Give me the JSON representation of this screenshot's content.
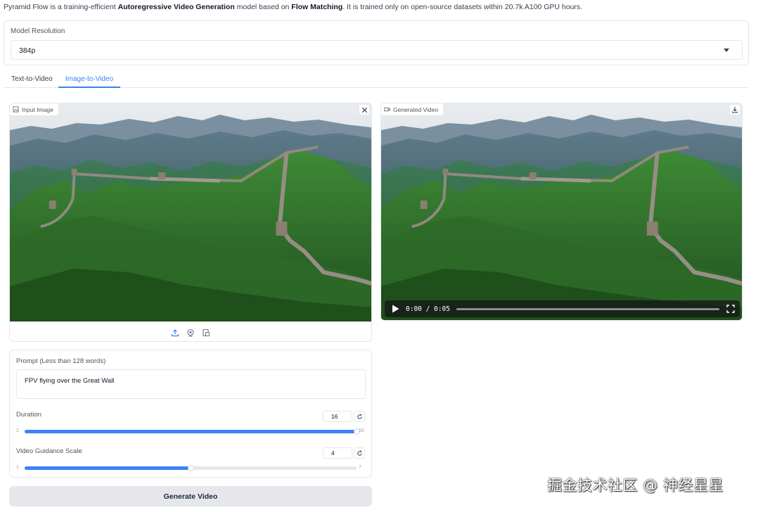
{
  "intro": {
    "p1": "Pyramid Flow is a training-efficient ",
    "b1": "Autoregressive Video Generation",
    "p2": " model based on ",
    "b2": "Flow Matching",
    "p3": ". It is trained only on open-source datasets within 20.7k A100 GPU hours."
  },
  "resolution": {
    "label": "Model Resolution",
    "value": "384p"
  },
  "tabs": [
    {
      "label": "Text-to-Video",
      "active": false
    },
    {
      "label": "Image-to-Video",
      "active": true
    }
  ],
  "input_image": {
    "label": "Input Image",
    "icons": [
      "image-icon",
      "close-icon",
      "upload-icon",
      "webcam-icon",
      "clipboard-icon"
    ]
  },
  "generated_video": {
    "label": "Generated Video",
    "time": "0:00 / 0:05",
    "progress": 0,
    "icons": [
      "video-icon",
      "download-icon",
      "play-icon",
      "fullscreen-icon"
    ]
  },
  "prompt": {
    "label": "Prompt (Less than 128 words)",
    "value": "FPV flying over the Great Wall"
  },
  "duration": {
    "label": "Duration",
    "value": "16",
    "min": "2",
    "max": "16",
    "fraction": 1.0
  },
  "guidance": {
    "label": "Video Guidance Scale",
    "value": "4",
    "min": "1",
    "max": "7",
    "fraction": 0.5
  },
  "generate_button": "Generate Video",
  "watermark": "掘金技术社区 @ 神经星星",
  "colors": {
    "accent": "#3b82f6",
    "button_bg": "#e5e7eb",
    "border": "#e5e7eb"
  }
}
